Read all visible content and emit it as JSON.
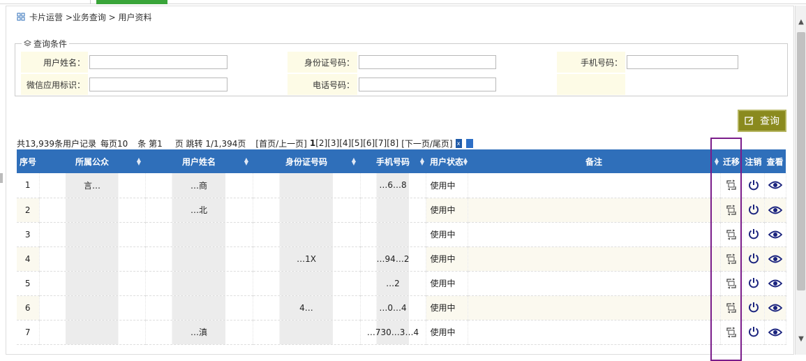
{
  "breadcrumb": "卡片运营 >业务查询 > 用户资料",
  "legend": "查询条件",
  "fields": {
    "user_name": {
      "label": "用户姓名：",
      "value": ""
    },
    "id_number": {
      "label": "身份证号码：",
      "value": ""
    },
    "mobile": {
      "label": "手机号码：",
      "value": ""
    },
    "wechat_id": {
      "label": "微信应用标识：",
      "value": ""
    },
    "phone": {
      "label": "电话号码：",
      "value": ""
    }
  },
  "query_button": "查询",
  "pager": {
    "total": "共13,939条用户记录",
    "per_page": "每页10",
    "per_unit": "条 第1",
    "jump": "页 跳转 1/1,394页",
    "first_prev": "[首页/上一页]",
    "current": "1",
    "pages": [
      "[2]",
      "[3]",
      "[4]",
      "[5]",
      "[6]",
      "[7]",
      "[8]"
    ],
    "next_last": "[下一页/尾页]"
  },
  "columns": [
    "序号",
    "所属公众",
    "用户姓名",
    "身份证号码",
    "手机号码",
    "用户状态",
    "备注",
    "迁移",
    "注销",
    "查看"
  ],
  "rows": [
    {
      "no": "1",
      "org": "言…",
      "name": "…商",
      "id": "",
      "mobile": "…6…8",
      "status": "使用中"
    },
    {
      "no": "2",
      "org": "",
      "name": "…北",
      "id": "",
      "mobile": "",
      "status": "使用中"
    },
    {
      "no": "3",
      "org": "",
      "name": "",
      "id": "",
      "mobile": "",
      "status": "使用中"
    },
    {
      "no": "4",
      "org": "",
      "name": "",
      "id": "…1X",
      "mobile": "…94…2",
      "status": "使用中"
    },
    {
      "no": "5",
      "org": "",
      "name": "",
      "id": "",
      "mobile": "…2",
      "status": "使用中"
    },
    {
      "no": "6",
      "org": "",
      "name": "",
      "id": "4…",
      "mobile": "…0…4",
      "status": "使用中"
    },
    {
      "no": "7",
      "org": "",
      "name": "…滇",
      "id": "",
      "mobile": "…730…3…4",
      "status": "使用中"
    }
  ],
  "colors": {
    "header": "#2f6fba",
    "highlight": "#7a1c8a",
    "button": "#8a8a1e",
    "icon": "#1a237e"
  }
}
